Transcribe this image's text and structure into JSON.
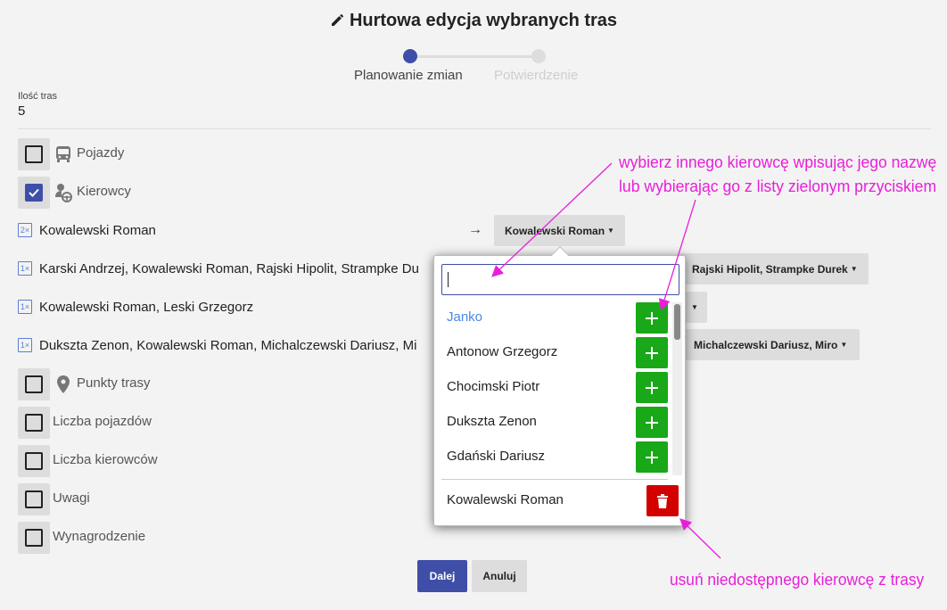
{
  "header": {
    "title": "Hurtowa edycja wybranych tras"
  },
  "stepper": {
    "step1": "Planowanie zmian",
    "step2": "Potwierdzenie"
  },
  "summary": {
    "count_label": "Ilość tras",
    "count_value": "5"
  },
  "sections": {
    "vehicles": "Pojazdy",
    "drivers": "Kierowcy",
    "route_points": "Punkty trasy",
    "vehicle_count": "Liczba pojazdów",
    "driver_count": "Liczba kierowców",
    "notes": "Uwagi",
    "pay": "Wynagrodzenie"
  },
  "driver_groups": [
    {
      "badge": "2×",
      "names": "Kowalewski Roman",
      "target": "Kowalewski Roman"
    },
    {
      "badge": "1×",
      "names": "Karski Andrzej, Kowalewski Roman, Rajski Hipolit, Strampke Du",
      "target": "Rajski Hipolit, Strampke Durek"
    },
    {
      "badge": "1×",
      "names": "Kowalewski Roman, Leski Grzegorz",
      "target": ""
    },
    {
      "badge": "1×",
      "names": "Dukszta Zenon, Kowalewski Roman, Michalczewski Dariusz, Mi",
      "target": "Michalczewski Dariusz, Miro"
    }
  ],
  "arrow": "→",
  "dropdown": {
    "search_value": "",
    "options": [
      "Janko",
      "Antonow Grzegorz",
      "Chocimski Piotr",
      "Dukszta Zenon",
      "Gdański Dariusz"
    ],
    "current": "Kowalewski Roman"
  },
  "buttons": {
    "next": "Dalej",
    "cancel": "Anuluj"
  },
  "annotations": {
    "top_line1": "wybierz innego kierowcę wpisując jego nazwę",
    "top_line2": "lub wybierając go z listy zielonym przyciskiem",
    "bottom": "usuń niedostępnego kierowcę z trasy"
  },
  "colors": {
    "accent": "#3f4fa8",
    "add": "#19a817",
    "delete": "#d30000",
    "annotation": "#e81fd9",
    "link": "#4a86e8"
  }
}
